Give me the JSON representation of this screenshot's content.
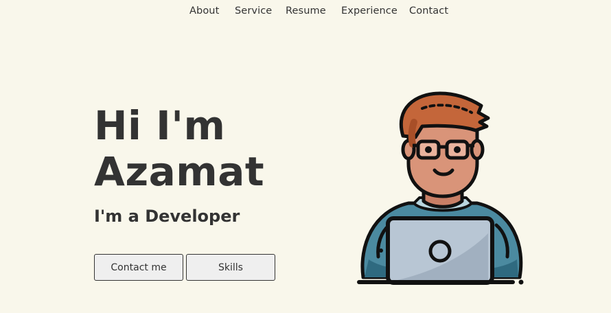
{
  "nav": {
    "items": [
      {
        "label": "About"
      },
      {
        "label": "Service"
      },
      {
        "label": "Resume"
      },
      {
        "label": "Experience"
      },
      {
        "label": "Contact"
      }
    ]
  },
  "hero": {
    "title_line1": "Hi I'm",
    "title_line2": "Azamat",
    "subtitle": "I'm a Developer",
    "buttons": {
      "contact": "Contact me",
      "skills": "Skills"
    }
  },
  "illustration": {
    "icon": "developer-with-laptop-illustration"
  },
  "colors": {
    "background": "#f9f7eb",
    "text": "#333333",
    "button_bg": "#efefef",
    "hair": "#c4663a",
    "skin": "#d99479",
    "shirt": "#4b8aa0",
    "laptop": "#b8c6d4"
  }
}
